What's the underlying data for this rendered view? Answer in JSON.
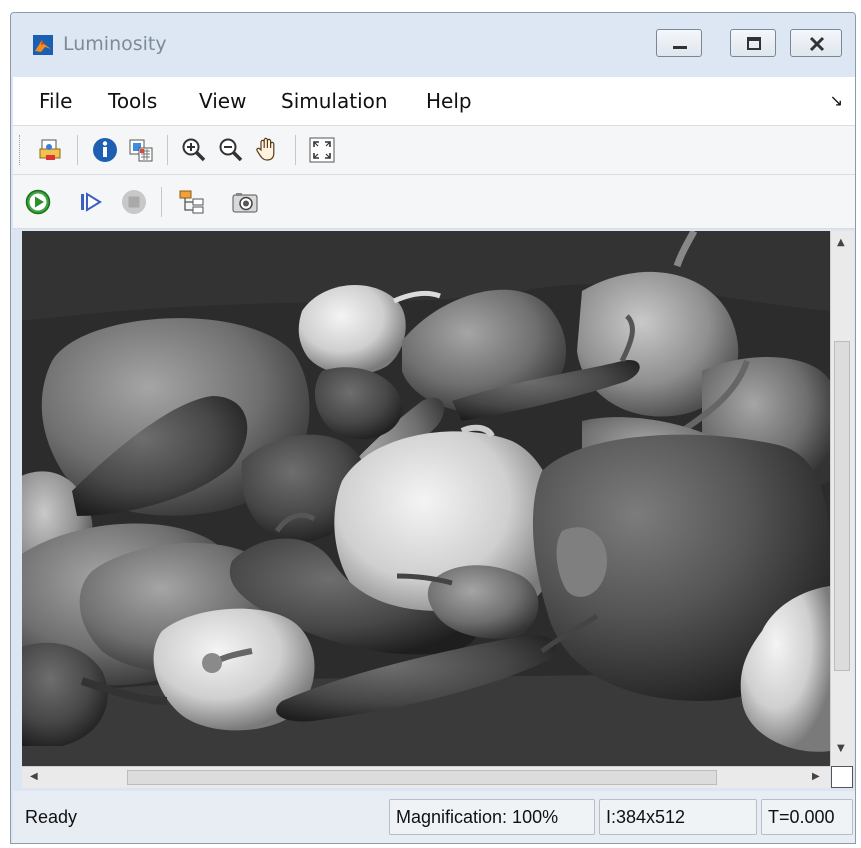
{
  "window": {
    "title": "Luminosity"
  },
  "menubar": {
    "items": [
      {
        "label": "File"
      },
      {
        "label": "Tools"
      },
      {
        "label": "View"
      },
      {
        "label": "Simulation"
      },
      {
        "label": "Help"
      }
    ]
  },
  "toolbar": {
    "row1": [
      "print-export-icon",
      "info-icon",
      "image-properties-icon",
      "zoom-in-icon",
      "zoom-out-icon",
      "pan-hand-icon",
      "fit-to-view-icon"
    ],
    "row2": [
      "run-icon",
      "step-forward-icon",
      "stop-icon",
      "model-hierarchy-icon",
      "snapshot-icon"
    ]
  },
  "viewport": {
    "image_description_icon": "grayscale-peppers-image"
  },
  "statusbar": {
    "status": "Ready",
    "magnification": "Magnification: 100%",
    "dimensions": "I:384x512",
    "time": "T=0.000"
  }
}
